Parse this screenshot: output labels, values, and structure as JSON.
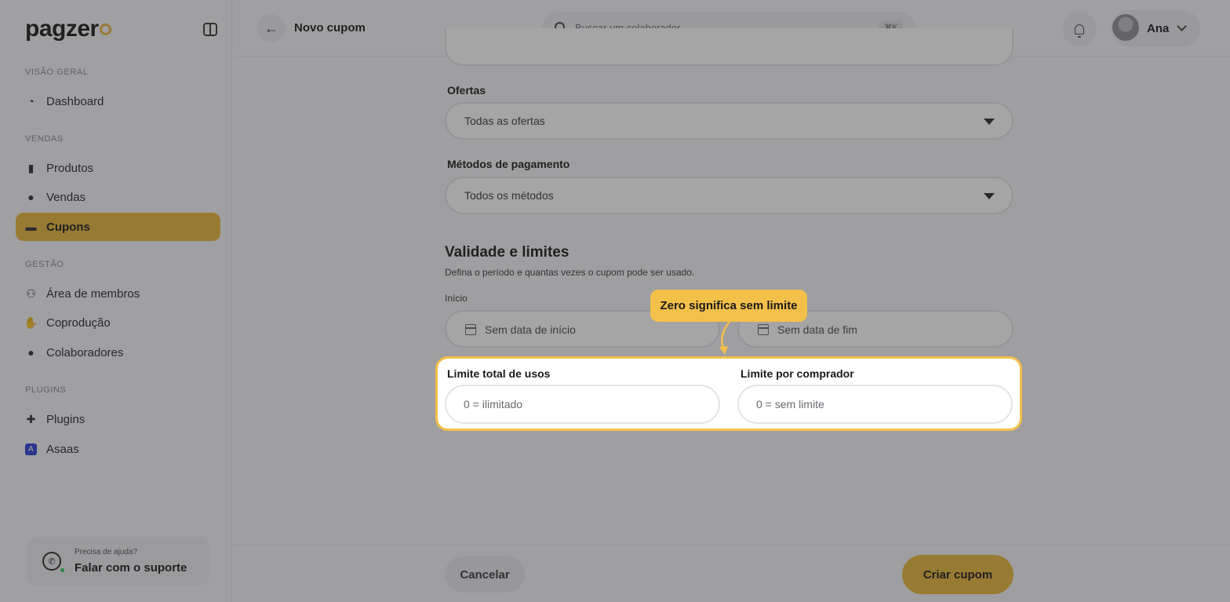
{
  "sidebar": {
    "logo_text": "pagzer",
    "sections": {
      "overview": "VISÃO GERAL",
      "sales": "VENDAS",
      "management": "GESTÃO",
      "plugins": "PLUGINS"
    },
    "items": {
      "dashboard": "Dashboard",
      "produtos": "Produtos",
      "vendas": "Vendas",
      "cupons": "Cupons",
      "area_membros": "Área de membros",
      "coproducao": "Coprodução",
      "colaboradores": "Colaboradores",
      "plugins": "Plugins",
      "asaas": "Asaas"
    },
    "support": {
      "small": "Precisa de ajuda?",
      "big": "Falar com o suporte"
    }
  },
  "header": {
    "title": "Novo cupom",
    "search_placeholder": "Buscar um colaborador",
    "shortcut": "⌘K",
    "user_name": "Ana"
  },
  "form": {
    "ofertas_label": "Ofertas",
    "ofertas_value": "Todas as ofertas",
    "metodos_label": "Métodos de pagamento",
    "metodos_value": "Todos os métodos",
    "validity_title": "Validade e limites",
    "validity_desc": "Defina o período e quantas vezes o cupom pode ser usado.",
    "inicio_label": "Início",
    "inicio_placeholder": "Sem data de início",
    "fim_placeholder": "Sem data de fim",
    "limite_total_label": "Limite total de usos",
    "limite_total_placeholder": "0 = ilimitado",
    "limite_comprador_label": "Limite por comprador",
    "limite_comprador_placeholder": "0 = sem limite"
  },
  "tooltip": "Zero significa sem limite",
  "footer": {
    "cancel": "Cancelar",
    "create": "Criar cupom"
  },
  "colors": {
    "accent": "#e8b73a",
    "highlight": "#f3c04a"
  }
}
